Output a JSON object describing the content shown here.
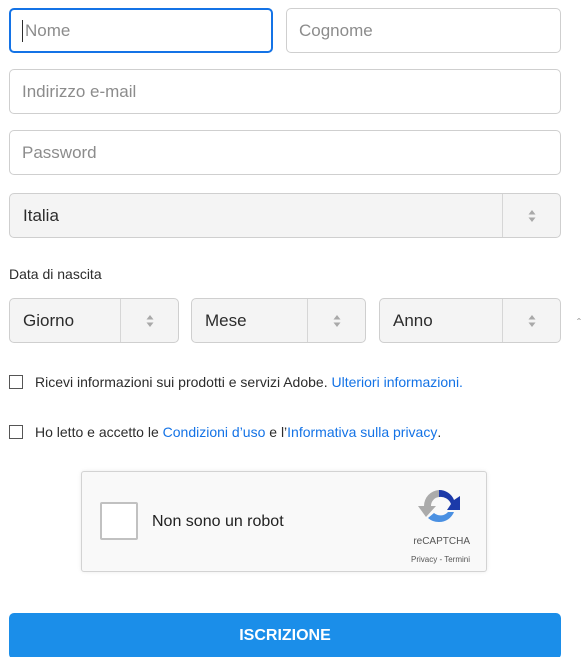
{
  "form": {
    "first_name_placeholder": "Nome",
    "last_name_placeholder": "Cognome",
    "email_placeholder": "Indirizzo e-mail",
    "password_placeholder": "Password",
    "country_value": "Italia",
    "birthdate_label": "Data di nascita",
    "day_value": "Giorno",
    "month_value": "Mese",
    "year_value": "Anno",
    "marketing_text": "Ricevi informazioni sui prodotti e servizi Adobe.",
    "marketing_link": "Ulteriori informazioni.",
    "terms_prefix": "Ho letto e accetto le",
    "terms_link": "Condizioni d’uso",
    "terms_middle": "e l’",
    "privacy_link": "Informativa sulla privacy",
    "terms_suffix": ".",
    "submit_label": "ISCRIZIONE"
  },
  "recaptcha": {
    "label": "Non sono un robot",
    "brand": "reCAPTCHA",
    "links": "Privacy - Termini",
    "icon": "recaptcha-logo-icon"
  },
  "colors": {
    "accent": "#1473e6",
    "button": "#1b8ee9"
  }
}
